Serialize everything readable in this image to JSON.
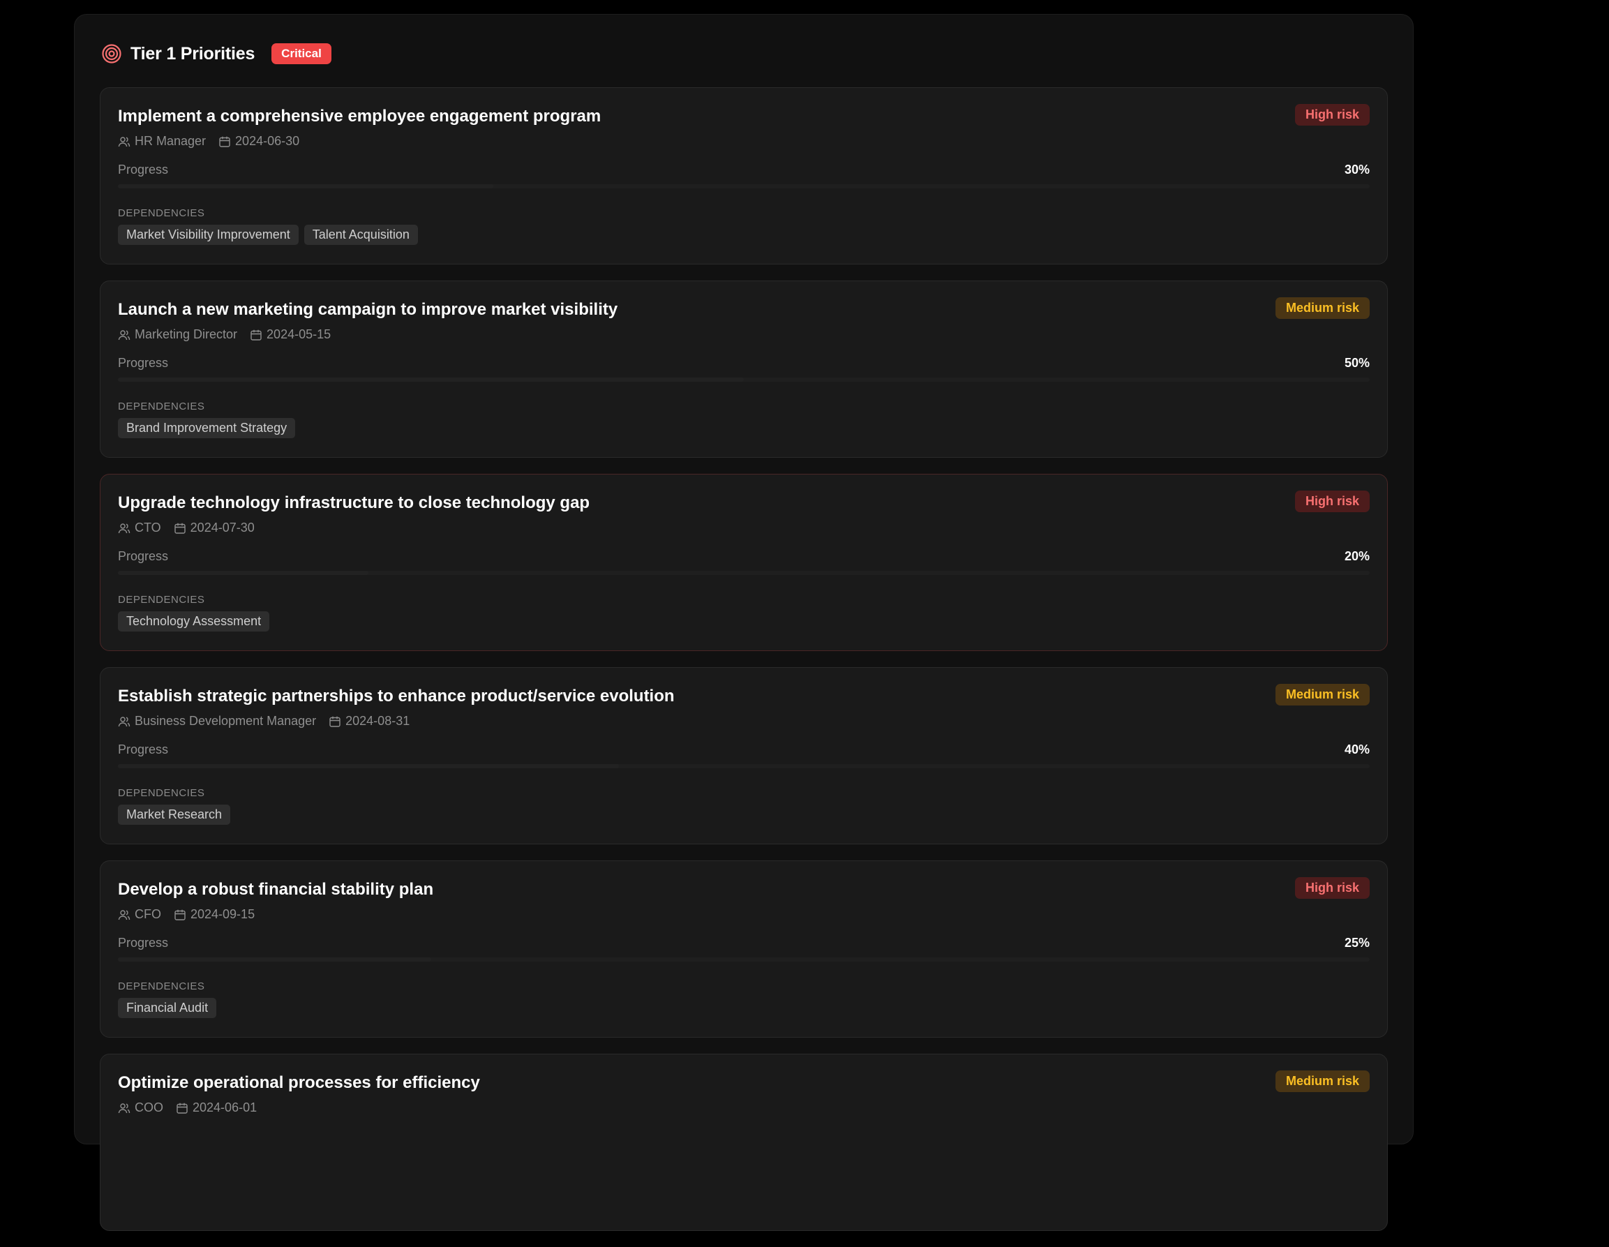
{
  "section": {
    "title": "Tier 1 Priorities",
    "badge": "Critical",
    "progress_label": "Progress",
    "dependencies_label": "DEPENDENCIES",
    "colors": {
      "critical": "#ef4444",
      "high_risk_text": "#f87171",
      "medium_risk_text": "#fbbf24"
    }
  },
  "priorities": [
    {
      "title": "Implement a comprehensive employee engagement program",
      "owner": "HR Manager",
      "due_date": "2024-06-30",
      "progress": "30%",
      "progress_value": 30,
      "risk": "High risk",
      "risk_level": "high",
      "dependencies": [
        "Market Visibility Improvement",
        "Talent Acquisition"
      ]
    },
    {
      "title": "Launch a new marketing campaign to improve market visibility",
      "owner": "Marketing Director",
      "due_date": "2024-05-15",
      "progress": "50%",
      "progress_value": 50,
      "risk": "Medium risk",
      "risk_level": "medium",
      "dependencies": [
        "Brand Improvement Strategy"
      ]
    },
    {
      "title": "Upgrade technology infrastructure to close technology gap",
      "owner": "CTO",
      "due_date": "2024-07-30",
      "progress": "20%",
      "progress_value": 20,
      "risk": "High risk",
      "risk_level": "high",
      "dependencies": [
        "Technology Assessment"
      ]
    },
    {
      "title": "Establish strategic partnerships to enhance product/service evolution",
      "owner": "Business Development Manager",
      "due_date": "2024-08-31",
      "progress": "40%",
      "progress_value": 40,
      "risk": "Medium risk",
      "risk_level": "medium",
      "dependencies": [
        "Market Research"
      ]
    },
    {
      "title": "Develop a robust financial stability plan",
      "owner": "CFO",
      "due_date": "2024-09-15",
      "progress": "25%",
      "progress_value": 25,
      "risk": "High risk",
      "risk_level": "high",
      "dependencies": [
        "Financial Audit"
      ]
    },
    {
      "title": "Optimize operational processes for efficiency",
      "owner": "COO",
      "due_date": "2024-06-01",
      "risk": "Medium risk",
      "risk_level": "medium"
    }
  ]
}
